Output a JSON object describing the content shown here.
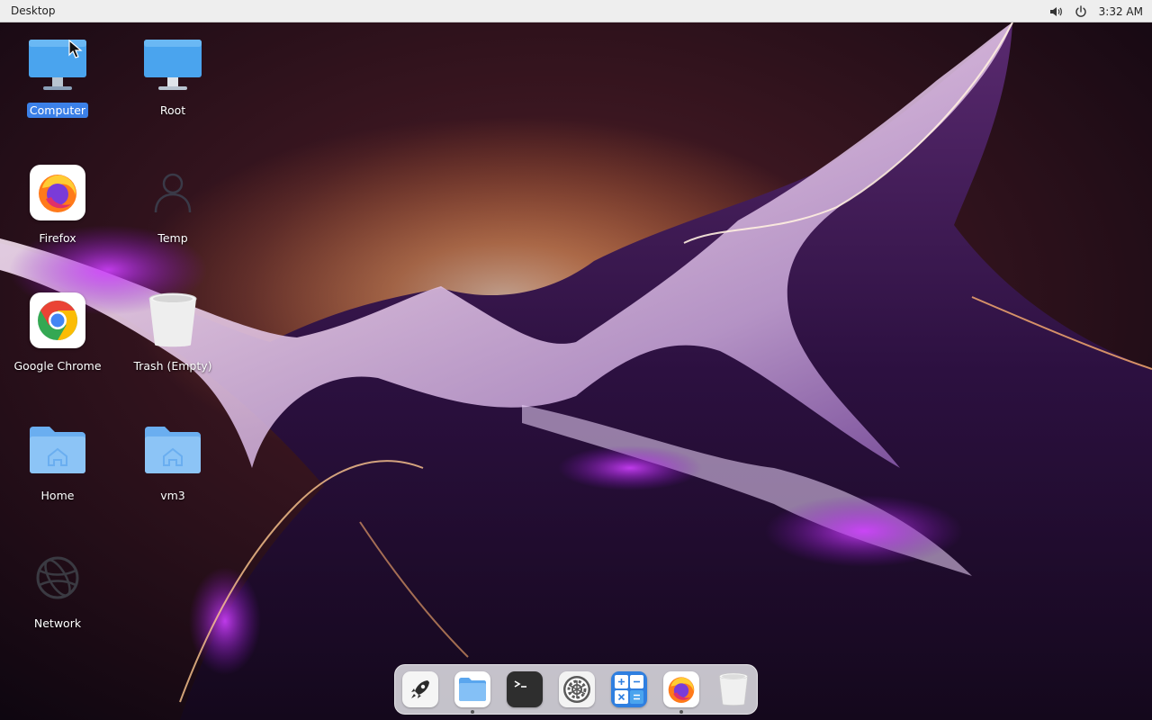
{
  "panel": {
    "title": "Desktop",
    "clock": "3:32 AM",
    "icons": [
      "volume-icon",
      "power-icon"
    ]
  },
  "desktop": {
    "icons": [
      {
        "label": "Computer",
        "icon": "computer-icon",
        "selected": true
      },
      {
        "label": "Root",
        "icon": "computer-icon"
      },
      {
        "label": "Firefox",
        "icon": "firefox-icon"
      },
      {
        "label": "Temp",
        "icon": "user-icon"
      },
      {
        "label": "Google Chrome",
        "icon": "chrome-icon"
      },
      {
        "label": "Trash (Empty)",
        "icon": "trash-icon"
      },
      {
        "label": "Home",
        "icon": "home-folder-icon"
      },
      {
        "label": "vm3",
        "icon": "home-folder-icon"
      },
      {
        "label": "Network",
        "icon": "network-icon"
      }
    ]
  },
  "dock": {
    "items": [
      {
        "name": "launcher",
        "icon": "rocket-icon"
      },
      {
        "name": "files",
        "icon": "folder-icon",
        "running": true
      },
      {
        "name": "terminal",
        "icon": "terminal-icon"
      },
      {
        "name": "settings",
        "icon": "gear-icon"
      },
      {
        "name": "calculator",
        "icon": "calculator-icon"
      },
      {
        "name": "firefox",
        "icon": "firefox-icon",
        "running": true
      },
      {
        "name": "trash",
        "icon": "trash-icon"
      }
    ]
  },
  "colors": {
    "selection": "#3b80e8",
    "folder": "#7db7f2",
    "wallpaper_glow": "#ff9a4a",
    "wallpaper_purple": "#a020d0"
  }
}
